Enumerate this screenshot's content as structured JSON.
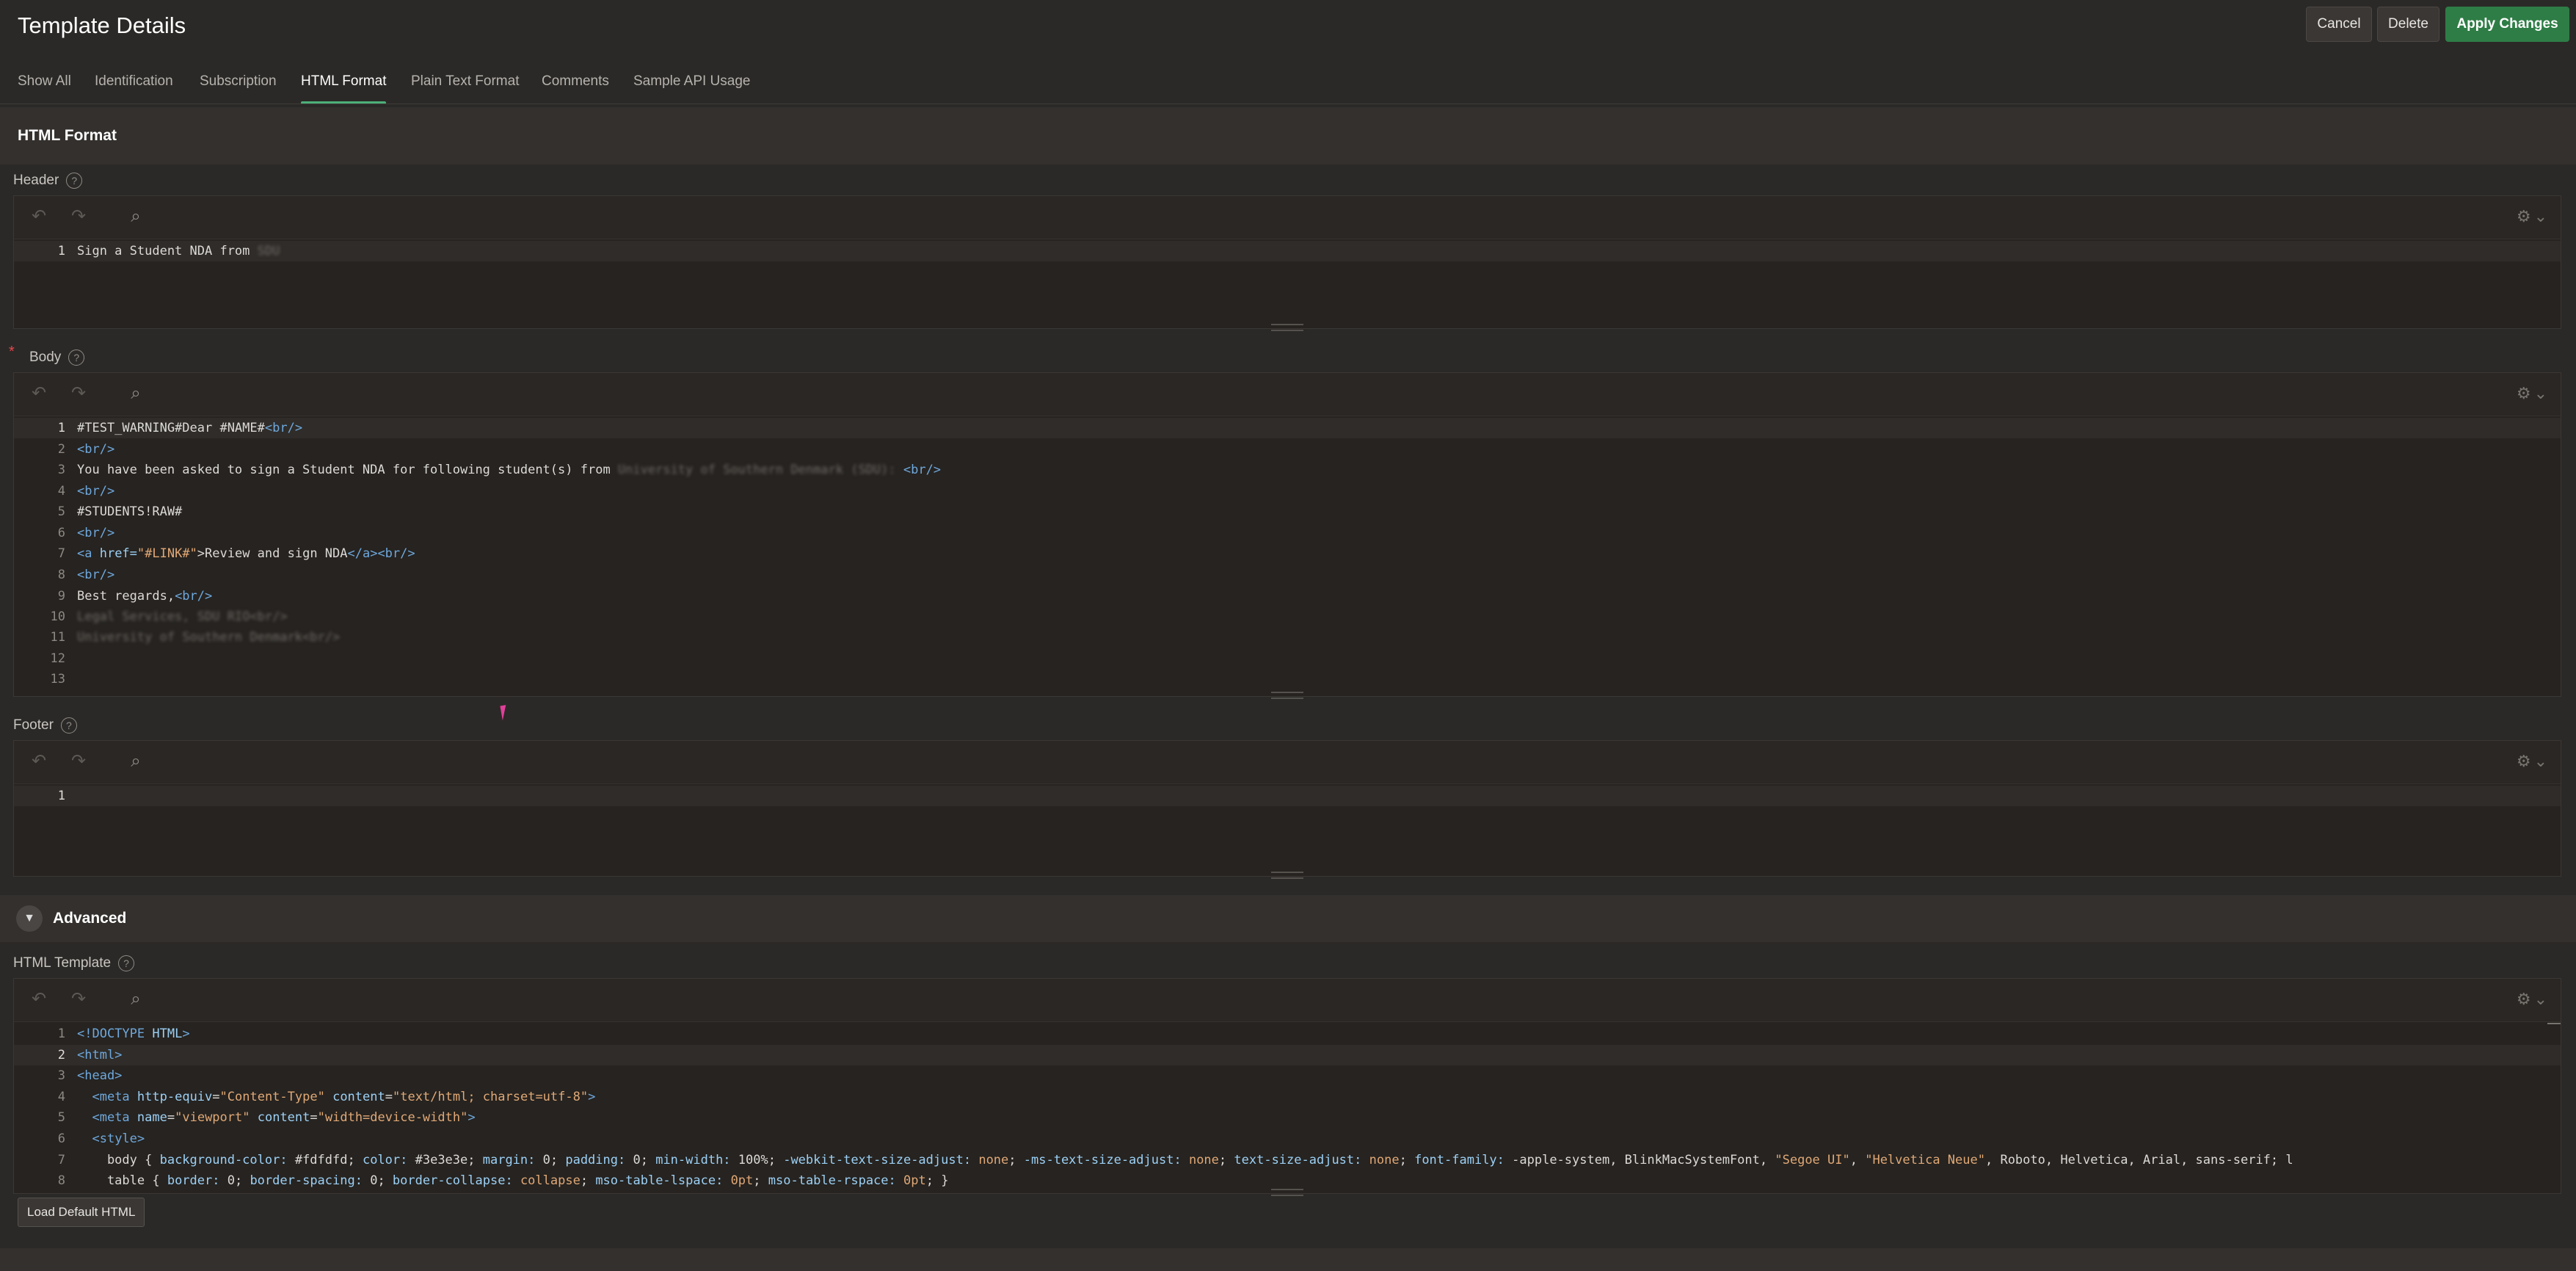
{
  "page": {
    "title": "Template Details",
    "buttons": {
      "cancel": "Cancel",
      "delete": "Delete",
      "apply": "Apply Changes"
    }
  },
  "tabs": [
    {
      "label": "Show All",
      "active": false
    },
    {
      "label": "Identification",
      "active": false
    },
    {
      "label": "Subscription",
      "active": false
    },
    {
      "label": "HTML Format",
      "active": true
    },
    {
      "label": "Plain Text Format",
      "active": false
    },
    {
      "label": "Comments",
      "active": false
    },
    {
      "label": "Sample API Usage",
      "active": false
    }
  ],
  "region": {
    "title": "HTML Format"
  },
  "header_field": {
    "label": "Header",
    "help_icon": "?",
    "lines": [
      {
        "num": "1",
        "text": "Sign a Student NDA from ",
        "blur": "SDU"
      }
    ]
  },
  "body_field": {
    "label": "Body",
    "required_marker": "*",
    "help_icon": "?",
    "lines": [
      {
        "num": "1",
        "text": "#TEST_WARNING#Dear #NAME#",
        "tag": "<br/>"
      },
      {
        "num": "2",
        "tag": "<br/>"
      },
      {
        "num": "3",
        "text": "You have been asked to sign a Student NDA for following student(s) from ",
        "blur": "University of Southern Denmark (SDU):",
        "tag": " <br/>"
      },
      {
        "num": "4",
        "tag": "<br/>"
      },
      {
        "num": "5",
        "text": "#STUDENTS!RAW#"
      },
      {
        "num": "6",
        "tag": "<br/>"
      },
      {
        "num": "7",
        "link_open": "<a ",
        "link_attr": "href=",
        "link_val": "\"#LINK#\"",
        "link_text": ">Review and sign NDA",
        "link_close": "</a><br/>"
      },
      {
        "num": "8",
        "tag": "<br/>"
      },
      {
        "num": "9",
        "text": "Best regards,",
        "tag": "<br/>"
      },
      {
        "num": "10",
        "blur": "Legal Services, SDU RIO<br/>"
      },
      {
        "num": "11",
        "blur": "University of Southern Denmark<br/>"
      },
      {
        "num": "12"
      },
      {
        "num": "13"
      }
    ]
  },
  "footer_field": {
    "label": "Footer",
    "help_icon": "?",
    "lines": [
      {
        "num": "1"
      }
    ]
  },
  "advanced": {
    "title": "Advanced",
    "toggle_icon": "▼"
  },
  "html_template_field": {
    "label": "HTML Template",
    "help_icon": "?",
    "lines": [
      {
        "num": "1",
        "html": "<span class=\"tag\">&lt;!DOCTYPE</span> <span class=\"attr\">HTML</span><span class=\"tag\">&gt;</span>"
      },
      {
        "num": "2",
        "html": "<span class=\"tag\">&lt;html&gt;</span>"
      },
      {
        "num": "3",
        "html": "<span class=\"tag\">&lt;head&gt;</span>"
      },
      {
        "num": "4",
        "html": "  <span class=\"tag\">&lt;meta</span> <span class=\"attr\">http-equiv</span>=<span class=\"str\">\"Content-Type\"</span> <span class=\"attr\">content</span>=<span class=\"str\">\"text/html; charset=utf-8\"</span><span class=\"tag\">&gt;</span>"
      },
      {
        "num": "5",
        "html": "  <span class=\"tag\">&lt;meta</span> <span class=\"attr\">name</span>=<span class=\"str\">\"viewport\"</span> <span class=\"attr\">content</span>=<span class=\"str\">\"width=device-width\"</span><span class=\"tag\">&gt;</span>"
      },
      {
        "num": "6",
        "html": "  <span class=\"tag\">&lt;style&gt;</span>"
      },
      {
        "num": "7",
        "html": "    body { <span class=\"attr\">background-color:</span> #fdfdfd; <span class=\"attr\">color:</span> #3e3e3e; <span class=\"attr\">margin:</span> 0; <span class=\"attr\">padding:</span> 0; <span class=\"attr\">min-width:</span> 100%; <span class=\"attr\">-webkit-text-size-adjust:</span> <span class=\"str\">none</span>; <span class=\"attr\">-ms-text-size-adjust:</span> <span class=\"str\">none</span>; <span class=\"attr\">text-size-adjust:</span> <span class=\"str\">none</span>; <span class=\"attr\">font-family:</span> -apple-system, BlinkMacSystemFont, <span class=\"str\">\"Segoe UI\"</span>, <span class=\"str\">\"Helvetica Neue\"</span>, Roboto, Helvetica, Arial, sans-serif; l"
      },
      {
        "num": "8",
        "html": "    table { <span class=\"attr\">border:</span> 0; <span class=\"attr\">border-spacing:</span> 0; <span class=\"attr\">border-collapse:</span> <span class=\"str\">collapse</span>; <span class=\"attr\">mso-table-lspace:</span> <span class=\"str\">0pt</span>; <span class=\"attr\">mso-table-rspace:</span> <span class=\"str\">0pt</span>; }"
      }
    ]
  },
  "load_default_button": "Load Default HTML",
  "icons": {
    "undo": "undo-icon",
    "redo": "redo-icon",
    "search": "search-icon",
    "settings": "gear-icon"
  },
  "colors": {
    "accent_green": "#2e7d46",
    "tab_indicator": "#4caf78",
    "required": "#e5484d"
  }
}
